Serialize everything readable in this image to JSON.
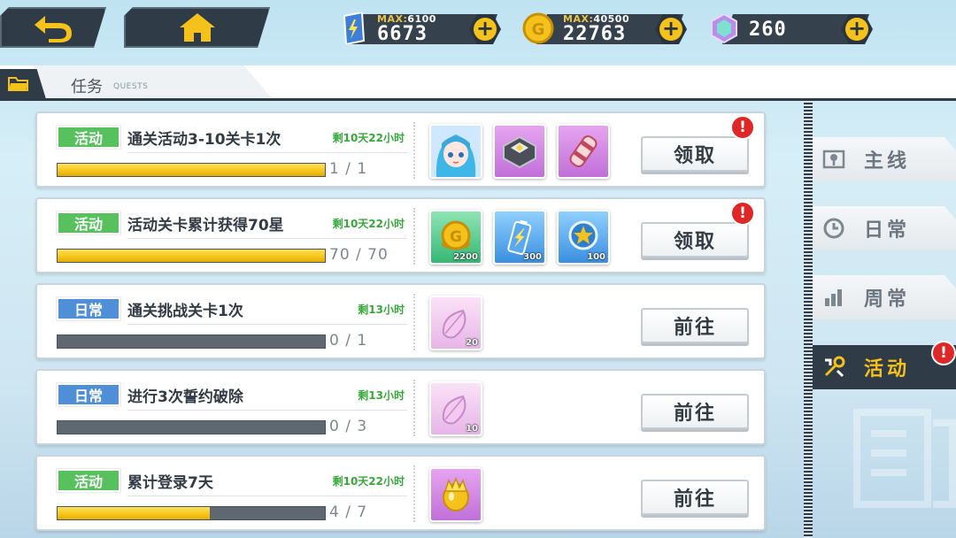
{
  "header": {
    "resources": [
      {
        "name": "stamina",
        "max_label": "MAX:",
        "max_value": "6100",
        "value": "6673",
        "icon": "battery-icon"
      },
      {
        "name": "coins",
        "max_label": "MAX:",
        "max_value": "40500",
        "value": "22763",
        "icon": "coin-icon"
      },
      {
        "name": "gems",
        "max_label": "",
        "max_value": "",
        "value": "260",
        "icon": "crystal-icon"
      }
    ],
    "plus": "+"
  },
  "title": {
    "main": "任务",
    "sub": "QUESTS"
  },
  "quests": [
    {
      "tag": "活动",
      "tag_type": "event",
      "name": "通关活动3-10关卡1次",
      "time": "剩10天22小时",
      "progress_text": "1 / 1",
      "progress": 1.0,
      "rewards": [
        {
          "icon": "character-portrait-icon",
          "color": "blue",
          "count": ""
        },
        {
          "icon": "crystal-box-icon",
          "color": "purple",
          "count": ""
        },
        {
          "icon": "scroll-item-icon",
          "color": "purple",
          "count": ""
        }
      ],
      "button": "领取",
      "alert": "!"
    },
    {
      "tag": "活动",
      "tag_type": "event",
      "name": "活动关卡累计获得70星",
      "time": "剩10天22小时",
      "progress_text": "70 / 70",
      "progress": 1.0,
      "rewards": [
        {
          "icon": "gold-coin-icon",
          "color": "green",
          "count": "2200"
        },
        {
          "icon": "battery-item-icon",
          "color": "blue",
          "count": "300"
        },
        {
          "icon": "star-medal-icon",
          "color": "blue",
          "count": "100"
        }
      ],
      "button": "领取",
      "alert": "!"
    },
    {
      "tag": "日常",
      "tag_type": "daily",
      "name": "通关挑战关卡1次",
      "time": "剩13小时",
      "progress_text": "0 / 1",
      "progress": 0.0,
      "rewards": [
        {
          "icon": "petal-icon",
          "color": "pink",
          "count": "20"
        }
      ],
      "button": "前往",
      "alert": ""
    },
    {
      "tag": "日常",
      "tag_type": "daily",
      "name": "进行3次誓约破除",
      "time": "剩13小时",
      "progress_text": "0 / 3",
      "progress": 0.0,
      "rewards": [
        {
          "icon": "petal-icon",
          "color": "pink",
          "count": "10"
        }
      ],
      "button": "前往",
      "alert": ""
    },
    {
      "tag": "活动",
      "tag_type": "event",
      "name": "累计登录7天",
      "time": "剩10天22小时",
      "progress_text": "4 / 7",
      "progress": 0.571,
      "rewards": [
        {
          "icon": "golden-egg-icon",
          "color": "purple",
          "count": ""
        }
      ],
      "button": "前往",
      "alert": ""
    }
  ],
  "side_tabs": [
    {
      "label": "主线",
      "icon": "map-pin-icon",
      "active": false
    },
    {
      "label": "日常",
      "icon": "clock-icon",
      "active": false
    },
    {
      "label": "周常",
      "icon": "bar-chart-icon",
      "active": false
    },
    {
      "label": "活动",
      "icon": "tools-icon",
      "active": true
    }
  ],
  "side_alert": "!"
}
